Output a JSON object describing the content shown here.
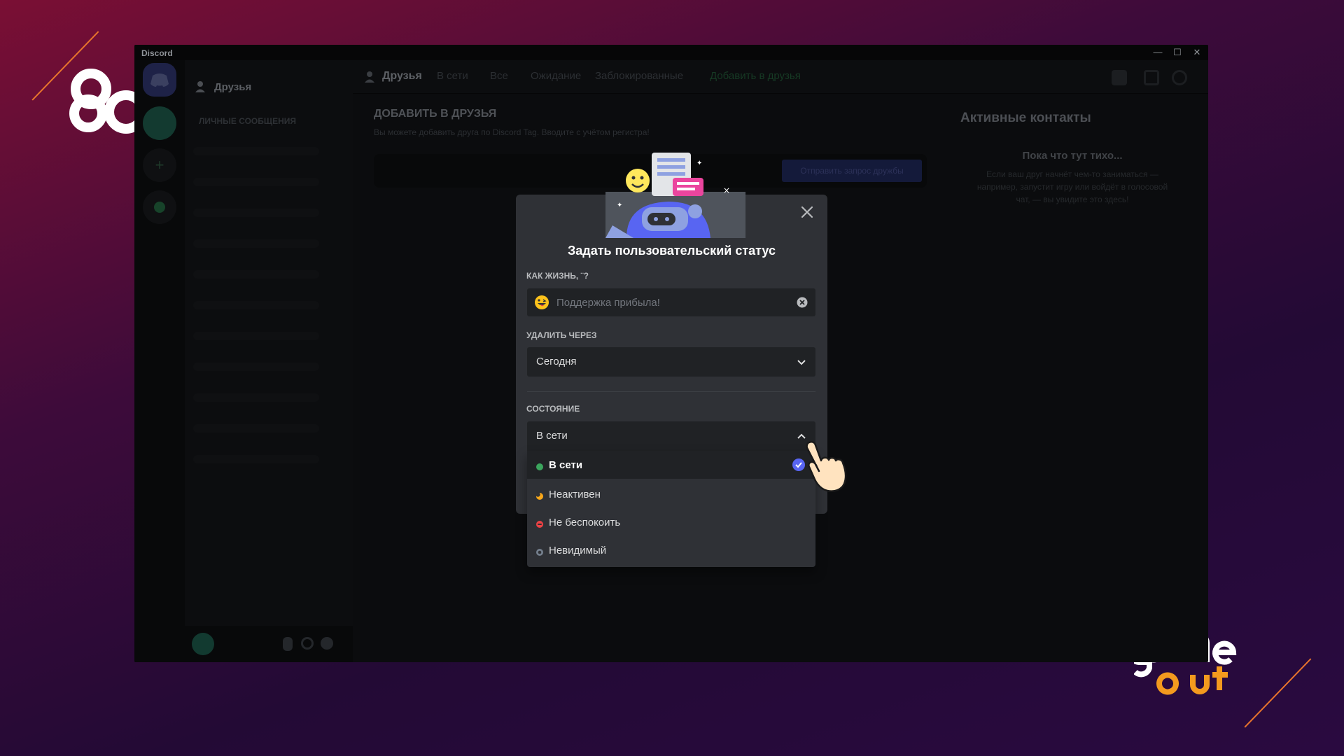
{
  "window": {
    "app_name": "Discord",
    "controls": {
      "minimize": "—",
      "maximize": "☐",
      "close": "✕"
    }
  },
  "sidebar": {
    "friends_label": "Друзья",
    "dm_header": "Личные сообщения"
  },
  "top_nav": {
    "title": "Друзья",
    "tabs": [
      "В сети",
      "Все",
      "Ожидание",
      "Заблокированные"
    ],
    "add_friend_tab": "Добавить в друзья"
  },
  "add_friend": {
    "title": "ДОБАВИТЬ В ДРУЗЬЯ",
    "subtitle": "Вы можете добавить друга по Discord Tag. Вводите с учётом регистра!",
    "button": "Отправить запрос дружбы"
  },
  "active_contacts": {
    "title": "Активные контакты",
    "empty_title": "Пока что тут тихо...",
    "empty_text": "Если ваш друг начнёт чем-то заниматься — например, запустит игру или войдёт в голосовой чат, — вы увидите это здесь!"
  },
  "modal": {
    "title": "Задать пользовательский статус",
    "status_field": {
      "label": "КАК ЖИЗНЬ, ¨?",
      "placeholder": "Поддержка прибыла!",
      "value": ""
    },
    "clear_after": {
      "label": "УДАЛИТЬ ЧЕРЕЗ",
      "value": "Сегодня"
    },
    "state": {
      "label": "СОСТОЯНИЕ",
      "value": "В сети",
      "options": [
        {
          "label": "В сети",
          "color": "#3ba55d",
          "selected": true
        },
        {
          "label": "Неактивен",
          "color": "#faa81a",
          "selected": false
        },
        {
          "label": "Не беспокоить",
          "color": "#ed4245",
          "selected": false
        },
        {
          "label": "Невидимый",
          "color": "#747f8d",
          "selected": false
        }
      ]
    }
  },
  "colors": {
    "accent": "#5865f2",
    "modal_bg": "#2f3136",
    "input_bg": "#202225"
  }
}
